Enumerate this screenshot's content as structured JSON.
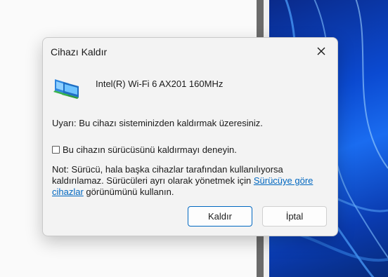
{
  "dialog": {
    "title": "Cihazı Kaldır",
    "device_name": "Intel(R) Wi-Fi 6 AX201 160MHz",
    "warning": "Uyarı: Bu cihazı sisteminizden kaldırmak üzeresiniz.",
    "checkbox_label": "Bu cihazın sürücüsünü kaldırmayı deneyin.",
    "checkbox_checked": false,
    "note_before_link": "Not: Sürücü, hala başka cihazlar tarafından kullanılıyorsa kaldırılamaz. Sürücüleri ayrı olarak yönetmek için ",
    "note_link": "Sürücüye göre cihazlar",
    "note_after_link": " görünümünü kullanın.",
    "buttons": {
      "uninstall": "Kaldır",
      "cancel": "İptal"
    }
  },
  "icons": {
    "close": "close-icon",
    "device": "network-adapter-icon"
  },
  "colors": {
    "link": "#0067c0",
    "primary_border": "#0067c0",
    "wallpaper": "#0b4ad1"
  }
}
